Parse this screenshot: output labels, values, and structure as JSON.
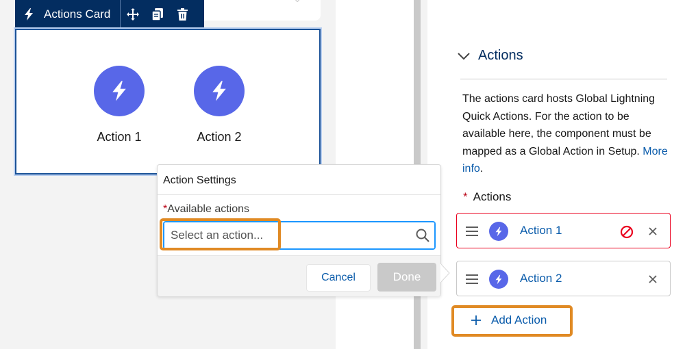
{
  "component_toolbar": {
    "title": "Actions Card",
    "icons": [
      "bolt-icon",
      "move-icon",
      "clone-icon",
      "delete-icon"
    ]
  },
  "actions_card": {
    "items": [
      {
        "label": "Action 1",
        "icon": "bolt-icon"
      },
      {
        "label": "Action 2",
        "icon": "bolt-icon"
      }
    ]
  },
  "action_settings": {
    "title": "Action Settings",
    "required_mark": "*",
    "field_label": "Available actions",
    "input_placeholder": "Select an action...",
    "input_value": "",
    "cancel_label": "Cancel",
    "done_label": "Done"
  },
  "properties_panel": {
    "section_title": "Actions",
    "description": "The actions card hosts Global Lightning Quick Actions. For the action to be available here, the component must be mapped as a Global Action in Setup.",
    "more_info_link": "More info",
    "description_end": ".",
    "actions_label": "Actions",
    "required_mark": "*",
    "action_rows": [
      {
        "label": "Action 1",
        "has_error": true
      },
      {
        "label": "Action 2",
        "has_error": false
      }
    ],
    "add_action_label": "Add Action"
  },
  "colors": {
    "toolbar_bg": "#032d60",
    "action_icon_bg": "#5867e8",
    "link": "#0b5cab",
    "error": "#ea001e",
    "highlight": "#e08a24",
    "focus": "#1b96ff"
  }
}
